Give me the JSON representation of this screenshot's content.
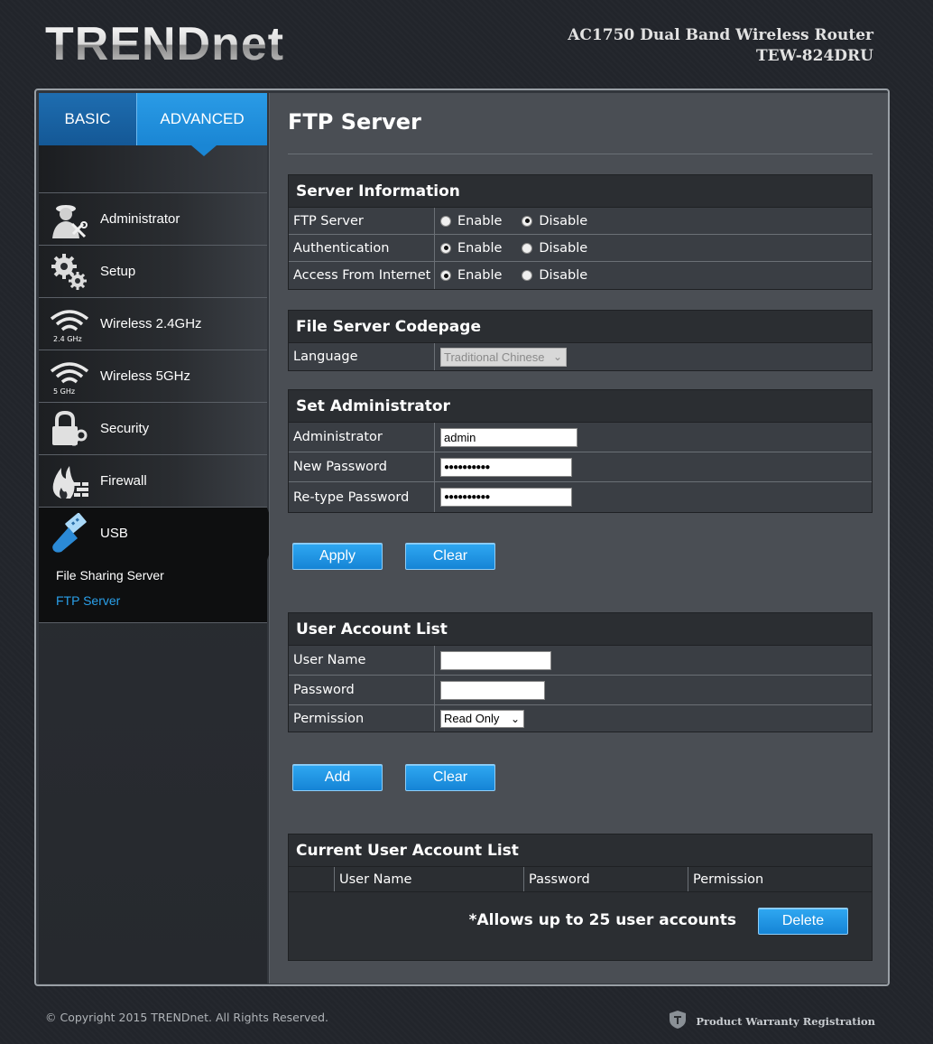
{
  "header": {
    "brand": "TRENDnet",
    "product_line1": "AC1750 Dual Band Wireless Router",
    "product_line2": "TEW-824DRU"
  },
  "tabs": [
    {
      "label": "BASIC",
      "active": false
    },
    {
      "label": "ADVANCED",
      "active": true
    }
  ],
  "sidebar": {
    "items": [
      {
        "label": "Administrator",
        "icon": "administrator-icon"
      },
      {
        "label": "Setup",
        "icon": "gears-icon"
      },
      {
        "label": "Wireless 2.4GHz",
        "icon": "wifi-icon",
        "sub": "2.4 GHz"
      },
      {
        "label": "Wireless 5GHz",
        "icon": "wifi-icon",
        "sub": "5 GHz"
      },
      {
        "label": "Security",
        "icon": "lock-key-icon"
      },
      {
        "label": "Firewall",
        "icon": "firewall-icon"
      },
      {
        "label": "USB",
        "icon": "usb-icon",
        "active": true
      }
    ],
    "sub_items": [
      {
        "label": "File Sharing Server",
        "active": false
      },
      {
        "label": "FTP Server",
        "active": true
      }
    ]
  },
  "page": {
    "title": "FTP Server"
  },
  "server_info": {
    "heading": "Server Information",
    "enable_label": "Enable",
    "disable_label": "Disable",
    "rows": [
      {
        "label": "FTP Server",
        "value": "Disable"
      },
      {
        "label": "Authentication",
        "value": "Enable"
      },
      {
        "label": "Access From Internet",
        "value": "Enable"
      }
    ]
  },
  "codepage": {
    "heading": "File Server Codepage",
    "language_label": "Language",
    "language_value": "Traditional Chinese"
  },
  "admin": {
    "heading": "Set Administrator",
    "admin_label": "Administrator",
    "admin_value": "admin",
    "new_password_label": "New Password",
    "new_password_value": "●●●●●●●●●●",
    "retype_label": "Re-type Password",
    "retype_value": "●●●●●●●●●●"
  },
  "buttons": {
    "apply": "Apply",
    "clear": "Clear",
    "add": "Add",
    "delete": "Delete"
  },
  "user_account": {
    "heading": "User Account List",
    "username_label": "User Name",
    "username_value": "",
    "password_label": "Password",
    "password_value": "",
    "permission_label": "Permission",
    "permission_value": "Read Only"
  },
  "current_list": {
    "heading": "Current User Account List",
    "columns": [
      "",
      "User Name",
      "Password",
      "Permission"
    ],
    "note": "*Allows up to 25 user accounts"
  },
  "footer": {
    "copyright": "© Copyright 2015 TRENDnet. All Rights Reserved.",
    "warranty": "Product Warranty Registration"
  },
  "colors": {
    "accent_blue": "#1a86d4",
    "active_sub_item": "#2aa0ea",
    "panel_bg": "#4a4e54"
  }
}
